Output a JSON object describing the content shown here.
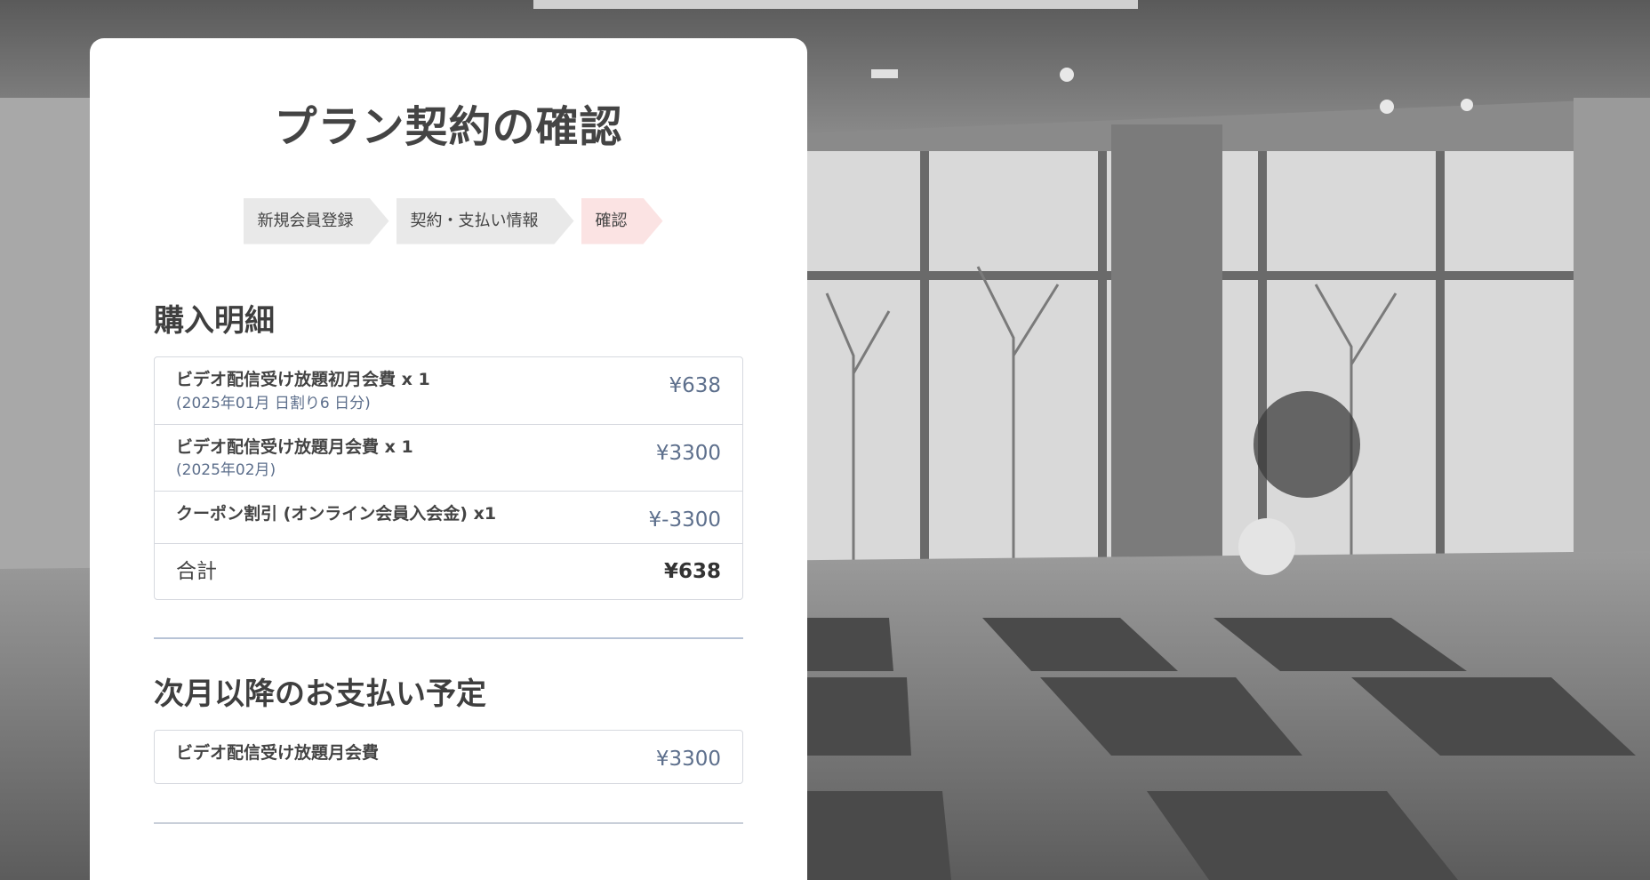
{
  "page": {
    "title": "プラン契約の確認"
  },
  "steps": [
    {
      "label": "新規会員登録",
      "state": "done"
    },
    {
      "label": "契約・支払い情報",
      "state": "done"
    },
    {
      "label": "確認",
      "state": "current"
    }
  ],
  "purchase": {
    "heading": "購入明細",
    "items": [
      {
        "label": "ビデオ配信受け放題初月会費 x 1",
        "sub": "(2025年01月 日割り6 日分)",
        "price": "¥638"
      },
      {
        "label": "ビデオ配信受け放題月会費 x 1",
        "sub": "(2025年02月)",
        "price": "¥3300"
      },
      {
        "label": "クーポン割引 (オンライン会員入会金) x1",
        "sub": "",
        "price": "¥-3300"
      }
    ],
    "total": {
      "label": "合計",
      "price": "¥638"
    }
  },
  "future": {
    "heading": "次月以降のお支払い予定",
    "items": [
      {
        "label": "ビデオ配信受け放題月会費",
        "price": "¥3300"
      }
    ]
  },
  "colors": {
    "step_done": "#e9e9e9",
    "step_current": "#fbe3e3",
    "price_text": "#5d6f8c",
    "divider": "#b7c3d6"
  }
}
